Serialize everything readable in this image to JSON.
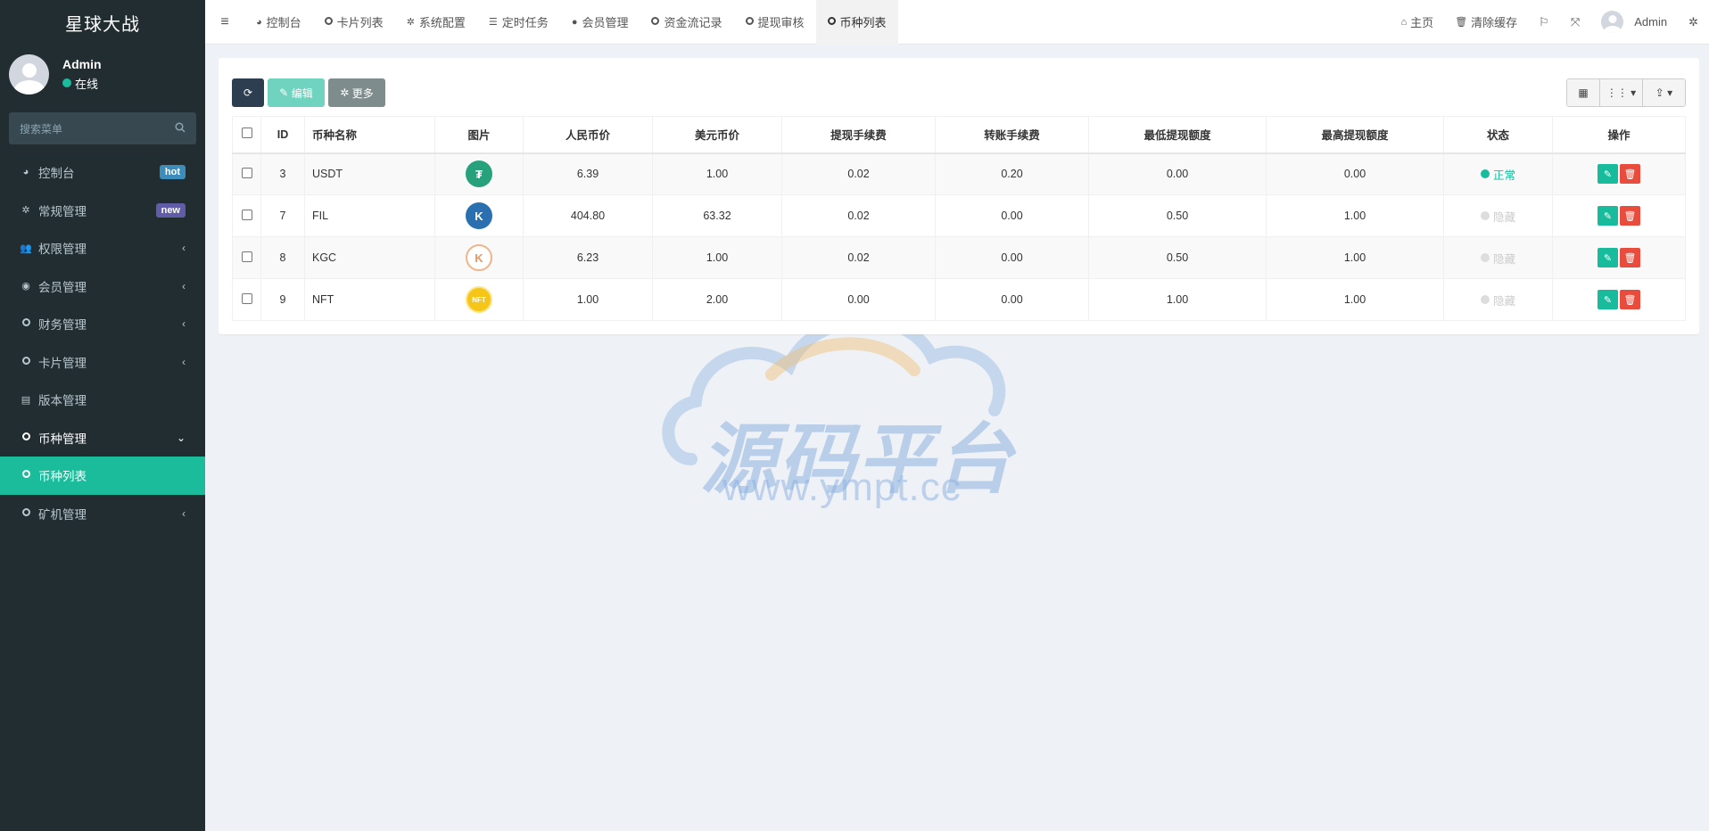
{
  "brand": "星球大战",
  "user": {
    "name": "Admin",
    "status": "在线",
    "status_color": "#1bbc9b"
  },
  "search": {
    "placeholder": "搜索菜单"
  },
  "sidebar": {
    "items": [
      {
        "label": "控制台",
        "icon": "dashboard-icon",
        "badge": "hot",
        "badge_color": "#3c8dbc"
      },
      {
        "label": "常规管理",
        "icon": "cogs-icon",
        "badge": "new",
        "badge_color": "#605ca8"
      },
      {
        "label": "权限管理",
        "icon": "group-icon"
      },
      {
        "label": "会员管理",
        "icon": "user-circle-icon"
      },
      {
        "label": "财务管理",
        "icon": "circle-icon"
      },
      {
        "label": "卡片管理",
        "icon": "circle-icon"
      },
      {
        "label": "版本管理",
        "icon": "file-icon"
      },
      {
        "label": "币种管理",
        "icon": "circle-icon"
      },
      {
        "label": "币种列表",
        "icon": "circle-icon"
      },
      {
        "label": "矿机管理",
        "icon": "circle-icon"
      }
    ]
  },
  "tabs": [
    {
      "label": "控制台",
      "icon": "dashboard-icon"
    },
    {
      "label": "卡片列表",
      "icon": "circle-icon"
    },
    {
      "label": "系统配置",
      "icon": "cog-icon"
    },
    {
      "label": "定时任务",
      "icon": "tasks-icon"
    },
    {
      "label": "会员管理",
      "icon": "user-icon"
    },
    {
      "label": "资金流记录",
      "icon": "circle-icon"
    },
    {
      "label": "提现审核",
      "icon": "circle-icon"
    },
    {
      "label": "币种列表",
      "icon": "circle-icon"
    }
  ],
  "topright": {
    "home": "主页",
    "clear_cache": "清除缓存",
    "admin": "Admin"
  },
  "toolbar": {
    "edit": "编辑",
    "more": "更多"
  },
  "table": {
    "headers": [
      "ID",
      "币种名称",
      "图片",
      "人民币价",
      "美元币价",
      "提现手续费",
      "转账手续费",
      "最低提现额度",
      "最高提现额度",
      "状态",
      "操作"
    ],
    "rows": [
      {
        "id": "3",
        "name": "USDT",
        "logo": "usdt-logo",
        "logo_color": "#26a17b",
        "cny": "6.39",
        "usd": "1.00",
        "withdraw_fee": "0.02",
        "transfer_fee": "0.20",
        "min": "0.00",
        "max": "0.00",
        "status": "正常"
      },
      {
        "id": "7",
        "name": "FIL",
        "logo": "fil-logo",
        "logo_color": "#2a6fb0",
        "cny": "404.80",
        "usd": "63.32",
        "withdraw_fee": "0.02",
        "transfer_fee": "0.00",
        "min": "0.50",
        "max": "1.00",
        "status": "隐藏"
      },
      {
        "id": "8",
        "name": "KGC",
        "logo": "kgc-logo",
        "logo_color": "#f0b48a",
        "cny": "6.23",
        "usd": "1.00",
        "withdraw_fee": "0.02",
        "transfer_fee": "0.00",
        "min": "0.50",
        "max": "1.00",
        "status": "隐藏"
      },
      {
        "id": "9",
        "name": "NFT",
        "logo": "nft-logo",
        "logo_color": "#f5c518",
        "cny": "1.00",
        "usd": "2.00",
        "withdraw_fee": "0.00",
        "transfer_fee": "0.00",
        "min": "1.00",
        "max": "1.00",
        "status": "隐藏"
      }
    ]
  },
  "watermark": {
    "text": "源码平台",
    "url": "www.ympt.cc"
  }
}
